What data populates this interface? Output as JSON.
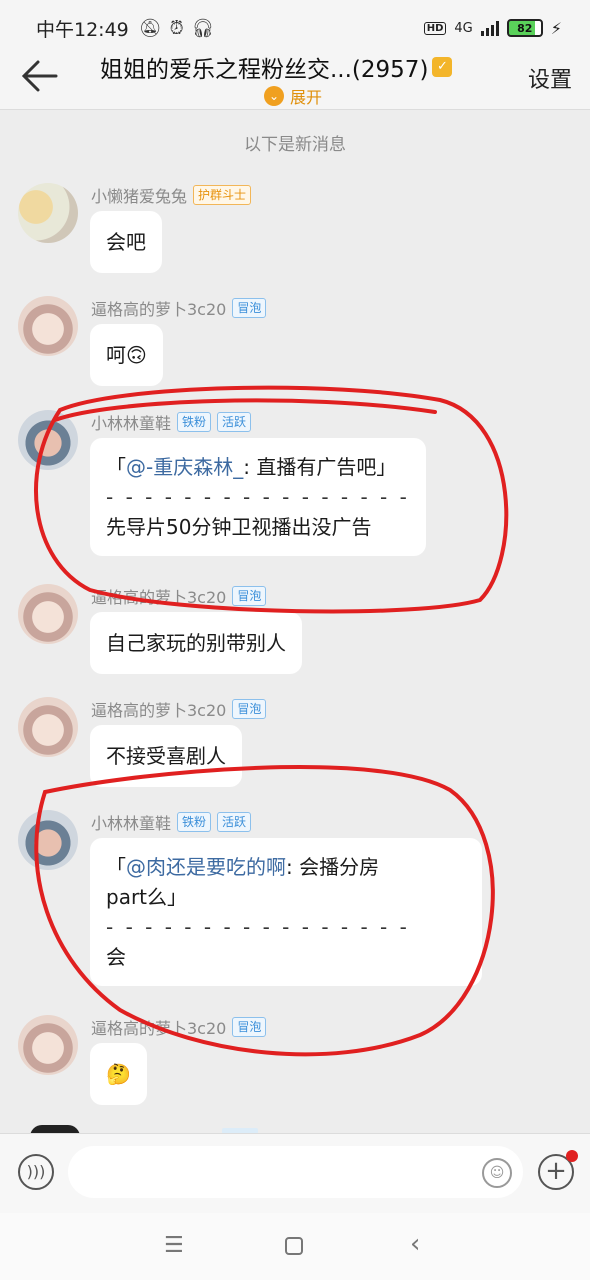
{
  "status": {
    "time": "中午12:49",
    "network": "4G",
    "battery": "82"
  },
  "header": {
    "title": "姐姐的爱乐之程粉丝交...(2957)",
    "expand_label": "展开",
    "settings_label": "设置"
  },
  "divider_text": "以下是新消息",
  "messages": [
    {
      "nick": "小懒猪爱兔兔",
      "badges": [
        "护群斗士"
      ],
      "text": "会吧"
    },
    {
      "nick": "逼格高的萝卜3c20",
      "badges": [
        "冒泡"
      ],
      "text": "呵🙃"
    },
    {
      "nick": "小林林童鞋",
      "badges": [
        "铁粉",
        "活跃"
      ],
      "quote_open": "「",
      "quote_at": "@-重庆森林_",
      "quote_rest": ": 直播有广告吧」",
      "dashes": "- - - - - - - - - - - - - - - -",
      "text": "先导片50分钟卫视播出没广告"
    },
    {
      "nick": "逼格高的萝卜3c20",
      "badges": [
        "冒泡"
      ],
      "text": "自己家玩的别带别人"
    },
    {
      "nick": "逼格高的萝卜3c20",
      "badges": [
        "冒泡"
      ],
      "text": "不接受喜剧人"
    },
    {
      "nick": "小林林童鞋",
      "badges": [
        "铁粉",
        "活跃"
      ],
      "quote_open": "「",
      "quote_at": "@肉还是要吃的啊",
      "quote_rest": ": 会播分房",
      "quote_line2": "part么」",
      "dashes": "- - - - - - - - - - - - - - - -",
      "text": "会"
    },
    {
      "nick": "逼格高的萝卜3c20",
      "badges": [
        "冒泡"
      ],
      "text": "🤔"
    }
  ],
  "input": {
    "placeholder": ""
  },
  "colors": {
    "annotation": "#e02020",
    "accent": "#f0a020"
  }
}
